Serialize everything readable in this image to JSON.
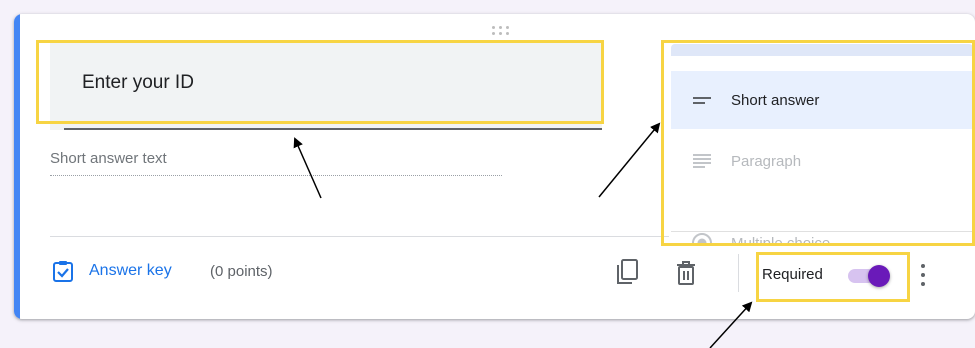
{
  "question": {
    "title": "Enter your ID",
    "answer_hint": "Short answer text"
  },
  "question_type_menu": {
    "items": [
      {
        "label": "Short answer",
        "icon": "short-answer-icon",
        "selected": true
      },
      {
        "label": "Paragraph",
        "icon": "paragraph-icon",
        "selected": false
      },
      {
        "label": "Multiple choice",
        "icon": "radio-icon",
        "selected": false
      }
    ]
  },
  "footer": {
    "answer_key_label": "Answer key",
    "points_label": "(0 points)",
    "required_label": "Required",
    "required_on": true
  },
  "colors": {
    "accent": "#4285f4",
    "link": "#1a73e8",
    "toggle_thumb": "#6a1ab9",
    "toggle_track": "#d7c3f0",
    "highlight": "#f7d443"
  }
}
